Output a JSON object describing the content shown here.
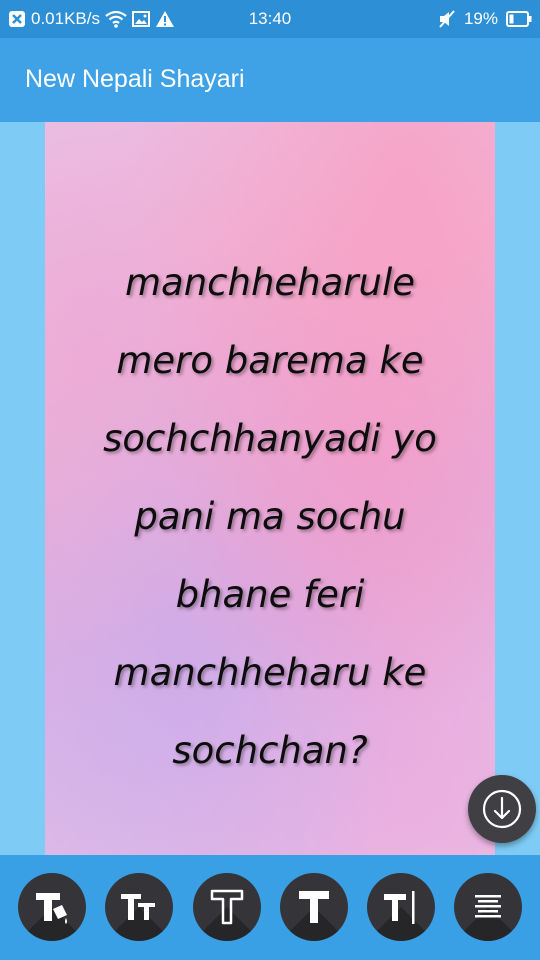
{
  "status_bar": {
    "speed": "0.01KB/s",
    "time": "13:40",
    "battery": "19%",
    "icons": [
      "notification-x-icon",
      "wifi-icon",
      "image-icon",
      "warning-icon",
      "mute-icon",
      "battery-icon"
    ]
  },
  "app_bar": {
    "title": "New Nepali Shayari"
  },
  "shayari": {
    "lines": [
      "manchheharule",
      "mero barema ke",
      "sochchhanyadi yo",
      "pani ma sochu",
      "bhane feri",
      "manchheharu ke",
      "sochchan?"
    ]
  },
  "fab": {
    "icon": "download-arrow-icon"
  },
  "toolbar": {
    "tools": [
      {
        "name": "text-color",
        "icon": "text-color-icon"
      },
      {
        "name": "text-size",
        "icon": "text-size-icon"
      },
      {
        "name": "text-outline",
        "icon": "text-outline-icon"
      },
      {
        "name": "text-bold",
        "icon": "text-bold-icon"
      },
      {
        "name": "text-cursor",
        "icon": "text-cursor-icon"
      },
      {
        "name": "text-align",
        "icon": "align-justify-icon"
      }
    ]
  },
  "colors": {
    "status_bar": "#2d8fd6",
    "app_bar": "#3fa2e6",
    "background": "#7ecbf5",
    "toolbar": "#3aa0e6",
    "button": "#353539"
  }
}
